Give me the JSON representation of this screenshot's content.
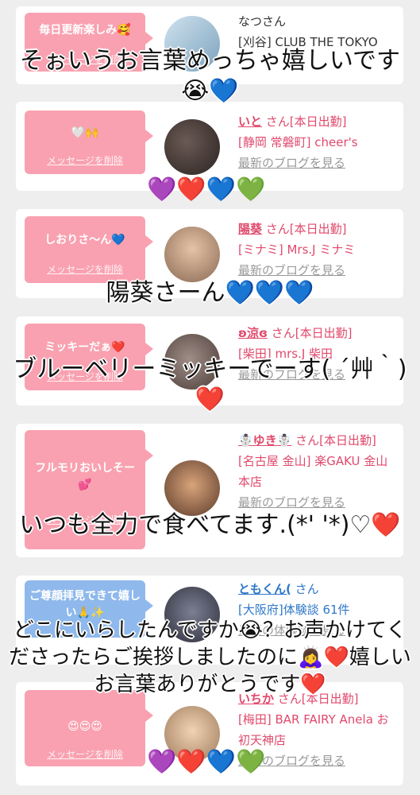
{
  "cards": [
    {
      "message": "毎日更新楽しみ🥰",
      "delete_label": "メッセージを削除",
      "name": "なつさん",
      "shop": "[刈谷] CLUB THE TOKYO",
      "blog": "",
      "bubble_color": "#f9a1b0"
    },
    {
      "message": "🤍🙌",
      "delete_label": "メッセージを削除",
      "name": "いと",
      "san": "さん[本日出勤]",
      "shop": "[静岡 常磐町] cheer's",
      "blog": "最新のブログを見る"
    },
    {
      "message": "しおりさ～ん💙",
      "delete_label": "メッセージを削除",
      "name": "陽葵",
      "san": "さん[本日出勤]",
      "shop": "[ミナミ] Mrs.J ミナミ",
      "blog": "最新のブログを見る"
    },
    {
      "message": "ミッキーだぁ❤️",
      "delete_label": "メッセージを削除",
      "name": "ʚ涼ɞ",
      "san": "さん[本日出勤]",
      "shop": "[柴田] mrs.J 柴田",
      "blog": "最新のブログを見る"
    },
    {
      "message": "フルモリおいしそー💕",
      "delete_label": "メッセージを削除",
      "name": "☃️ゆき☃️",
      "san": "さん[本日出勤]",
      "shop": "[名古屋 金山] 楽GAKU 金山本店",
      "blog": "最新のブログを見る"
    },
    {
      "message": "ご尊顔拝見できて嬉しい🙏✨",
      "delete_label": "",
      "name": "ともくん(",
      "san": "さん",
      "shop": "[大阪府]体験談 61件",
      "blog": "最新の体験談を見る",
      "bubble_color": "#8fb9ec"
    },
    {
      "message": "😍😍😍",
      "delete_label": "メッセージを削除",
      "name": "いちか",
      "san": "さん[本日出勤]",
      "shop": "[梅田] BAR FAIRY Anela お初天神店",
      "blog": "最新のブログを見る"
    }
  ],
  "overlays": {
    "o1": "そぉいうお言葉めっちゃ嬉しいです😭💙",
    "o2": "陽葵さーん💙💙💙",
    "o3": "ブルーベリーミッキーでーす( ´艸｀)❤️",
    "o4": "いつも全力で食べてます.(*' '*)♡❤️",
    "o5": "どこにいらしたんですか😭？お声かけてくださったらご挨拶しましたのに🙇‍♀️❤️嬉しいお言葉ありがとうです❤️"
  },
  "hearts1": "💜❤️💙💚",
  "hearts2": "💜❤️💙💚"
}
